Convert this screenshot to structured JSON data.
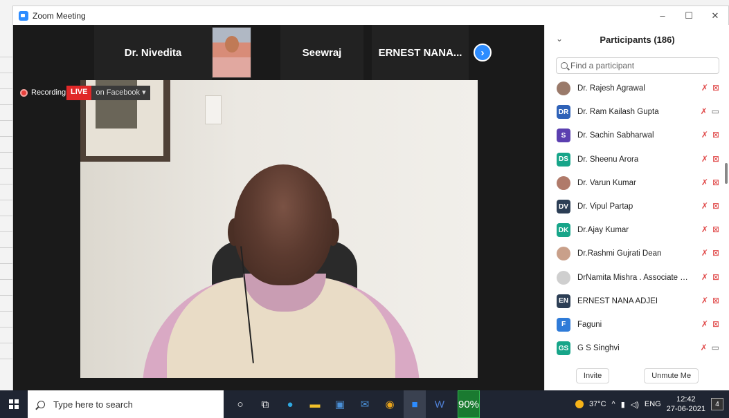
{
  "window": {
    "title": "Zoom Meeting",
    "minimize": "–",
    "maximize": "☐",
    "close": "✕"
  },
  "strip": {
    "tiles": [
      "Dr. Nivedita",
      "Seewraj",
      "ERNEST NANA..."
    ],
    "next_icon": "›"
  },
  "recording": {
    "label": "Recording",
    "live": "LIVE",
    "live_dest": "on Facebook ▾"
  },
  "panel": {
    "collapse_icon": "chevron-down",
    "title": "Participants (186)",
    "search_placeholder": "Find a participant",
    "participants": [
      {
        "initials": "",
        "name": "Dr. Rajesh Agrawal",
        "color": "#9a7a6a",
        "photo": true,
        "cam": "off"
      },
      {
        "initials": "DR",
        "name": "Dr. Ram Kailash Gupta",
        "color": "#2f62b8",
        "photo": false,
        "cam": "on"
      },
      {
        "initials": "S",
        "name": "Dr. Sachin Sabharwal",
        "color": "#5b3fb0",
        "photo": false,
        "cam": "off"
      },
      {
        "initials": "DS",
        "name": "Dr. Sheenu Arora",
        "color": "#17a589",
        "photo": false,
        "cam": "off"
      },
      {
        "initials": "",
        "name": "Dr. Varun Kumar",
        "color": "#b07a6a",
        "photo": true,
        "cam": "off"
      },
      {
        "initials": "DV",
        "name": "Dr. Vipul Partap",
        "color": "#2c3e55",
        "photo": false,
        "cam": "off"
      },
      {
        "initials": "DK",
        "name": "Dr.Ajay Kumar",
        "color": "#17a589",
        "photo": false,
        "cam": "off"
      },
      {
        "initials": "",
        "name": "Dr.Rashmi Gujrati Dean",
        "color": "#c9a08a",
        "photo": true,
        "cam": "off"
      },
      {
        "initials": "",
        "name": "DrNamita Mishra . Associate pr...",
        "color": "#cfcfcf",
        "photo": true,
        "cam": "off"
      },
      {
        "initials": "EN",
        "name": "ERNEST NANA ADJEI",
        "color": "#2c3e55",
        "photo": false,
        "cam": "off"
      },
      {
        "initials": "F",
        "name": "Faguni",
        "color": "#2f7bd8",
        "photo": false,
        "cam": "off"
      },
      {
        "initials": "GS",
        "name": "G S Singhvi",
        "color": "#17a589",
        "photo": false,
        "cam": "on"
      }
    ],
    "invite": "Invite",
    "unmute": "Unmute Me"
  },
  "taskbar": {
    "search_placeholder": "Type here to search",
    "battery": "90%",
    "weather": "37°C",
    "lang": "ENG",
    "time": "12:42",
    "date": "27-06-2021",
    "notifications": "4"
  }
}
